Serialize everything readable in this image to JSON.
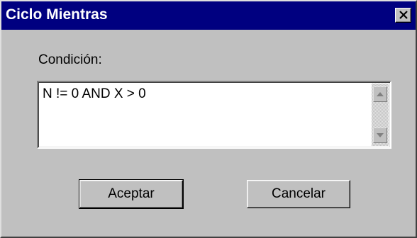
{
  "window": {
    "title": "Ciclo Mientras",
    "colors": {
      "titlebar": "#000080",
      "face": "#c0c0c0"
    }
  },
  "titlebar": {
    "close_icon": "close-icon"
  },
  "form": {
    "condition_label": "Condición:",
    "condition_value": "N != 0 AND X > 0"
  },
  "scrollbar": {
    "up_icon": "arrow-up-icon",
    "down_icon": "arrow-down-icon"
  },
  "buttons": {
    "accept_label": "Aceptar",
    "cancel_label": "Cancelar"
  }
}
